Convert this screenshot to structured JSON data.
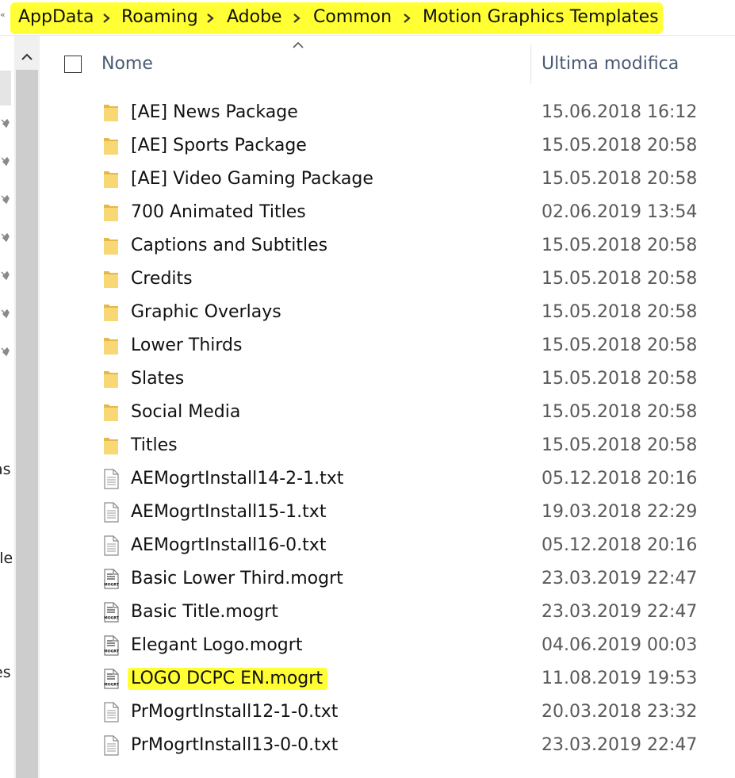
{
  "breadcrumb": {
    "collapse_glyph": "«",
    "segments": [
      "AppData",
      "Roaming",
      "Adobe",
      "Common",
      "Motion Graphics Templates"
    ],
    "highlight_color": "#ffff33"
  },
  "nav_pane": {
    "fragments": [
      "as",
      "ile",
      "es"
    ]
  },
  "columns": {
    "name": "Nome",
    "modified": "Ultima modifica"
  },
  "files": [
    {
      "name": "[AE] News Package",
      "modified": "15.06.2018 16:12",
      "type": "folder"
    },
    {
      "name": "[AE] Sports Package",
      "modified": "15.05.2018 20:58",
      "type": "folder"
    },
    {
      "name": "[AE] Video Gaming Package",
      "modified": "15.05.2018 20:58",
      "type": "folder"
    },
    {
      "name": "700 Animated Titles",
      "modified": "02.06.2019 13:54",
      "type": "folder"
    },
    {
      "name": "Captions and Subtitles",
      "modified": "15.05.2018 20:58",
      "type": "folder"
    },
    {
      "name": "Credits",
      "modified": "15.05.2018 20:58",
      "type": "folder"
    },
    {
      "name": "Graphic Overlays",
      "modified": "15.05.2018 20:58",
      "type": "folder"
    },
    {
      "name": "Lower Thirds",
      "modified": "15.05.2018 20:58",
      "type": "folder"
    },
    {
      "name": "Slates",
      "modified": "15.05.2018 20:58",
      "type": "folder"
    },
    {
      "name": "Social Media",
      "modified": "15.05.2018 20:58",
      "type": "folder"
    },
    {
      "name": "Titles",
      "modified": "15.05.2018 20:58",
      "type": "folder"
    },
    {
      "name": "AEMogrtInstall14-2-1.txt",
      "modified": "05.12.2018 20:16",
      "type": "txt"
    },
    {
      "name": "AEMogrtInstall15-1.txt",
      "modified": "19.03.2018 22:29",
      "type": "txt"
    },
    {
      "name": "AEMogrtInstall16-0.txt",
      "modified": "05.12.2018 20:16",
      "type": "txt"
    },
    {
      "name": "Basic Lower Third.mogrt",
      "modified": "23.03.2019 22:47",
      "type": "mogrt"
    },
    {
      "name": "Basic Title.mogrt",
      "modified": "23.03.2019 22:47",
      "type": "mogrt"
    },
    {
      "name": "Elegant Logo.mogrt",
      "modified": "04.06.2019 00:03",
      "type": "mogrt"
    },
    {
      "name": "LOGO DCPC EN.mogrt",
      "modified": "11.08.2019 19:53",
      "type": "mogrt",
      "highlighted": true
    },
    {
      "name": "PrMogrtInstall12-1-0.txt",
      "modified": "20.03.2018 23:32",
      "type": "txt"
    },
    {
      "name": "PrMogrtInstall13-0-0.txt",
      "modified": "23.03.2019 22:47",
      "type": "txt"
    }
  ],
  "icons": {
    "folder": "folder-icon",
    "txt": "text-file-icon",
    "mogrt": "mogrt-file-icon",
    "mogrt_label": "MOGRT"
  },
  "colors": {
    "folder": "#f8d775",
    "header_text": "#4a5b73",
    "date_text": "#5a5a5a"
  }
}
